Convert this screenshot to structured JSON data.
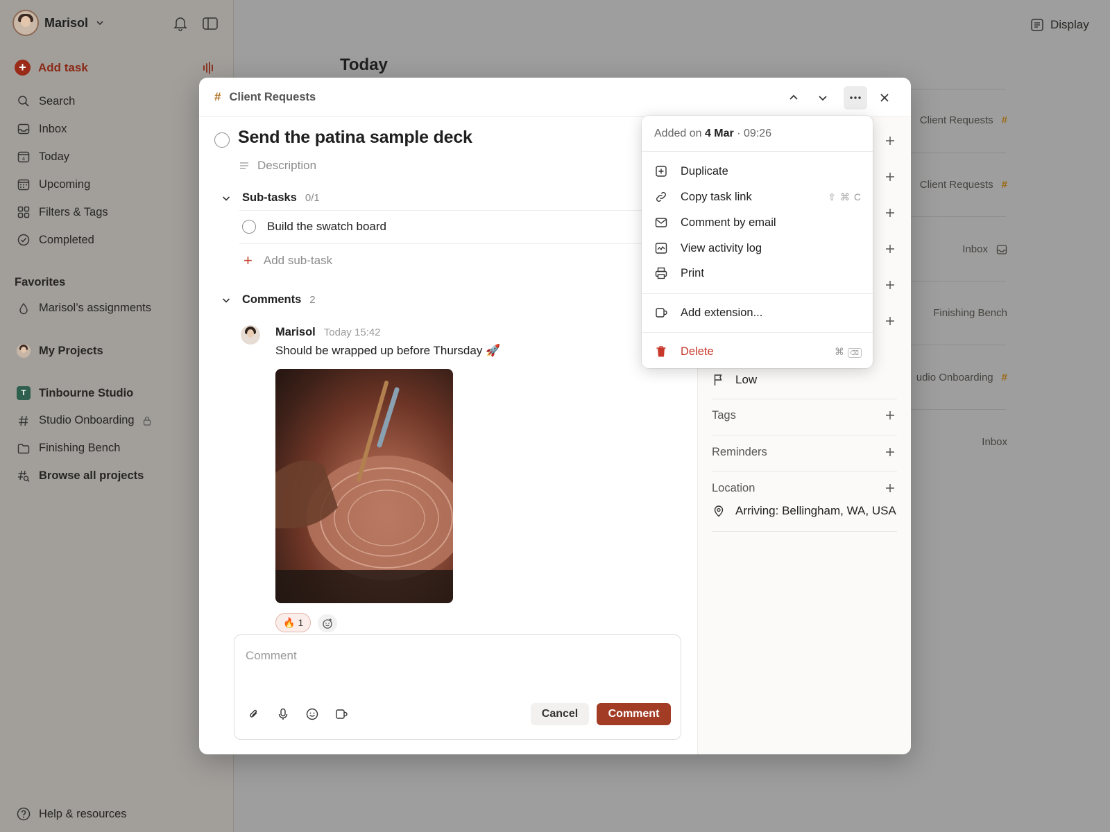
{
  "sidebar": {
    "user_name": "Marisol",
    "add_task": "Add task",
    "nav": [
      {
        "label": "Search",
        "icon": "search-icon"
      },
      {
        "label": "Inbox",
        "icon": "inbox-icon"
      },
      {
        "label": "Today",
        "icon": "calendar-today-icon"
      },
      {
        "label": "Upcoming",
        "icon": "calendar-upcoming-icon"
      },
      {
        "label": "Filters & Tags",
        "icon": "grid-icon"
      },
      {
        "label": "Completed",
        "icon": "check-circle-icon"
      }
    ],
    "favorites_heading": "Favorites",
    "favorite_item": "Marisol’s assignments",
    "my_projects": "My Projects",
    "workspace": {
      "badge": "T",
      "name": "Tinbourne Studio"
    },
    "projects": [
      "Studio Onboarding",
      "Finishing Bench"
    ],
    "browse_all": "Browse all projects",
    "help": "Help & resources"
  },
  "main": {
    "title": "Today",
    "display_label": "Display",
    "rows": [
      {
        "label": "Client Requests",
        "marker": "#"
      },
      {
        "label": "Client Requests",
        "marker": "#"
      },
      {
        "label": "Inbox",
        "marker": "inbox"
      },
      {
        "label": "Finishing Bench",
        "marker": ""
      },
      {
        "label": "udio Onboarding",
        "marker": "#"
      },
      {
        "label": "Inbox",
        "marker": ""
      }
    ]
  },
  "task": {
    "project": "Client Requests",
    "project_hash": "#",
    "title": "Send the patina sample deck",
    "description_placeholder": "Description",
    "subtasks_label": "Sub-tasks",
    "subtasks_count": "0/1",
    "subtask": "Build the swatch board",
    "add_subtask": "Add sub-task",
    "comments_label": "Comments",
    "comments_count": "2",
    "comment": {
      "author": "Marisol",
      "time": "Today 15:42",
      "text": "Should be wrapped up before Thursday 🚀",
      "reaction_emoji": "🔥",
      "reaction_count": "1"
    },
    "comment_placeholder": "Comment",
    "cancel_label": "Cancel",
    "comment_button": "Comment"
  },
  "details": {
    "priority": "Low",
    "tags_label": "Tags",
    "reminders_label": "Reminders",
    "location_label": "Location",
    "location_value": "Arriving: Bellingham, WA, USA"
  },
  "menu": {
    "added_prefix": "Added on ",
    "added_date": "4 Mar",
    "added_time": " · 09:26",
    "items": [
      {
        "label": "Duplicate",
        "shortcut": ""
      },
      {
        "label": "Copy task link",
        "shortcut": "⇧ ⌘ C"
      },
      {
        "label": "Comment by email",
        "shortcut": ""
      },
      {
        "label": "View activity log",
        "shortcut": ""
      },
      {
        "label": "Print",
        "shortcut": ""
      }
    ],
    "extension": "Add extension...",
    "delete": "Delete",
    "delete_shortcut": "⌘"
  },
  "colors": {
    "brand": "#a23c25",
    "project_hash": "#b0711e",
    "danger": "#c8382a"
  }
}
